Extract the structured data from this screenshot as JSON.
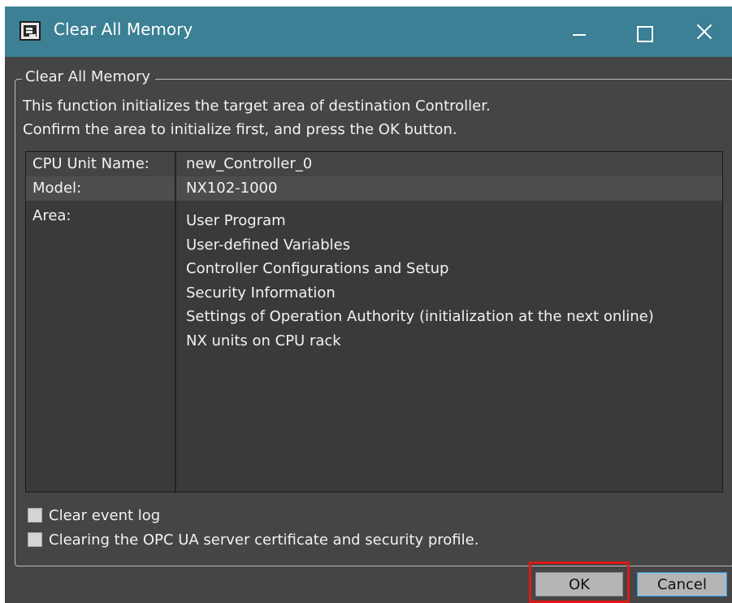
{
  "window": {
    "title": "Clear All Memory",
    "icon": "controller-app-icon",
    "controls": [
      "minimize-icon",
      "maximize-icon",
      "close-icon"
    ]
  },
  "group": {
    "legend": "Clear All Memory",
    "description_line1": "This function initializes the target area of destination Controller.",
    "description_line2": "Confirm the area to initialize first, and press the OK button."
  },
  "info_table": {
    "cpu_unit_name_label": "CPU Unit Name:",
    "cpu_unit_name_value": "new_Controller_0",
    "model_label": "Model:",
    "model_value": "NX102-1000",
    "area_label": "Area:",
    "areas": [
      "User Program",
      "User-defined Variables",
      "Controller Configurations and Setup",
      "Security Information",
      "Settings of Operation Authority (initialization at the next online)",
      "NX units on CPU rack"
    ]
  },
  "options": {
    "clear_event_log_label": "Clear event log",
    "clear_event_log_checked": false,
    "clear_opc_ua_label": "Clearing the OPC UA server certificate and security profile.",
    "clear_opc_ua_checked": false
  },
  "buttons": {
    "ok_label": "OK",
    "cancel_label": "Cancel"
  },
  "colors": {
    "titlebar": "#3b8094",
    "background": "#454545",
    "highlight": "#e01818"
  }
}
